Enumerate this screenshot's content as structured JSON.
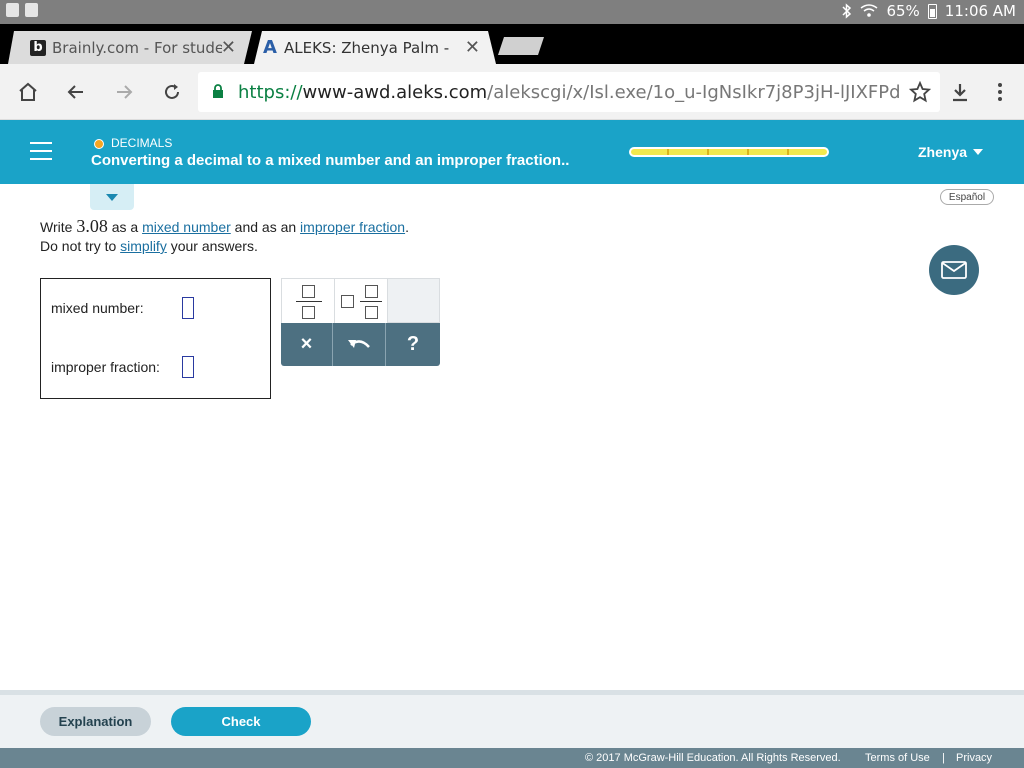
{
  "status_bar": {
    "battery": "65%",
    "time": "11:06 AM"
  },
  "tabs": [
    {
      "title": "Brainly.com - For studen",
      "favicon": "b",
      "active": false
    },
    {
      "title": "ALEKS: Zhenya Palm - L",
      "favicon": "A",
      "active": true
    }
  ],
  "address_bar": {
    "scheme": "https://",
    "host": "www-awd.aleks.com",
    "path": "/alekscgi/x/Isl.exe/1o_u-IgNsIkr7j8P3jH-lJIXFPd"
  },
  "header": {
    "topic_category": "DECIMALS",
    "topic_title": "Converting a decimal to a mixed number and an improper fraction..",
    "progress_segments": 6,
    "user_name": "Zhenya",
    "accent_color": "#1aa3c8",
    "topic_dot_color": "#f5a623"
  },
  "language_toggle": "Español",
  "question": {
    "write": "Write",
    "number": "3.08",
    "as_a": "as a",
    "mixed_number_link": "mixed number",
    "and_as_an": "and as an",
    "improper_fraction_link": "improper fraction",
    "period": ".",
    "do_not_try": "Do not try to",
    "simplify_link": "simplify",
    "your_answers": "your answers."
  },
  "answers": {
    "mixed_number_label": "mixed number:",
    "improper_fraction_label": "improper fraction:"
  },
  "palette": {
    "clear_symbol": "×",
    "help_symbol": "?"
  },
  "buttons": {
    "explanation": "Explanation",
    "check": "Check"
  },
  "footer": {
    "copyright": "© 2017 McGraw-Hill Education. All Rights Reserved.",
    "terms": "Terms of Use",
    "separator": "|",
    "privacy": "Privacy"
  }
}
